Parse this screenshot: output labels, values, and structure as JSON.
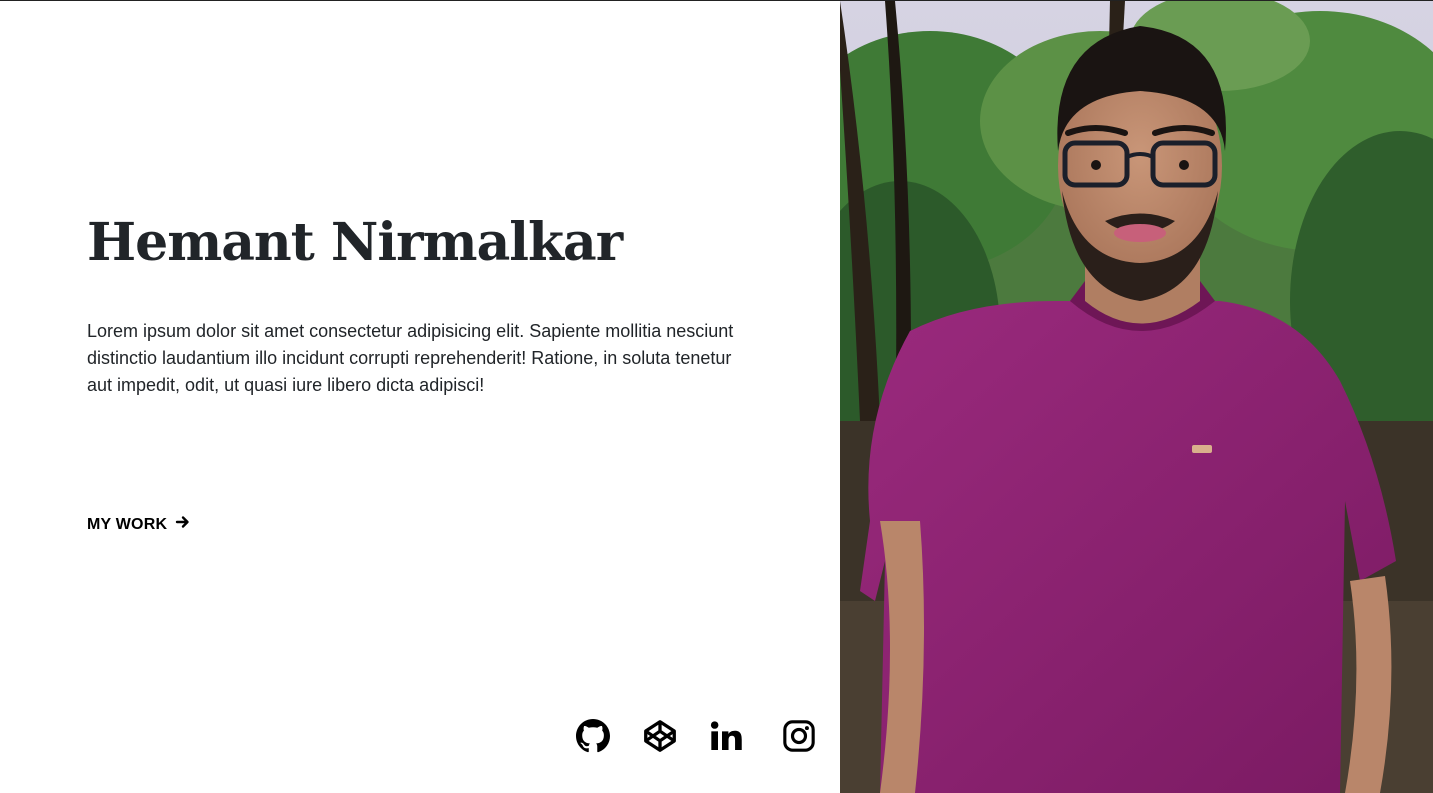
{
  "hero": {
    "name": "Hemant Nirmalkar",
    "bio": "Lorem ipsum dolor sit amet consectetur adipisicing elit. Sapiente mollitia nesciunt distinctio laudantium illo incidunt corrupti reprehenderit! Ratione, in soluta tenetur aut impedit, odit, ut quasi iure libero dicta adipisci!",
    "cta_label": "MY WORK"
  },
  "social": [
    {
      "icon": "github-icon"
    },
    {
      "icon": "codepen-icon"
    },
    {
      "icon": "linkedin-icon"
    },
    {
      "icon": "instagram-icon"
    }
  ],
  "colors": {
    "text": "#212529",
    "background": "#ffffff",
    "shirt": "#8a1f6e",
    "foliage": "#3f7a36"
  }
}
